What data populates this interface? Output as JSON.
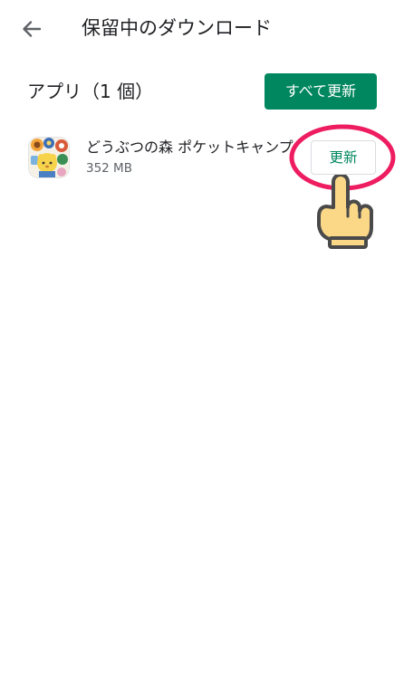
{
  "header": {
    "back_icon": "arrow-back-icon",
    "title": "保留中のダウンロード"
  },
  "apps_section": {
    "title": "アプリ（1 個）",
    "update_all_label": "すべて更新",
    "accent_color": "#01875f"
  },
  "apps": [
    {
      "name": "どうぶつの森 ポケットキャンプ",
      "size": "352 MB",
      "icon": "animal-crossing-pocket-camp-icon",
      "update_label": "更新"
    }
  ],
  "annotations": {
    "highlight_color": "#ee1c60",
    "pointer_icon": "pointing-hand-icon"
  }
}
